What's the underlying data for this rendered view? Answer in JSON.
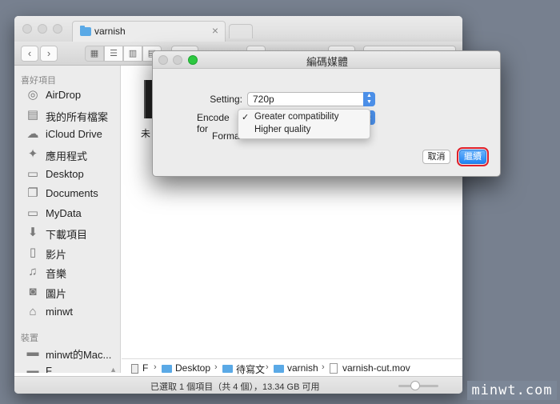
{
  "finder": {
    "tab_title": "varnish",
    "tab_close": "×",
    "sidebar": {
      "favorites_header": "喜好項目",
      "favorites": [
        {
          "label": "AirDrop",
          "icon": "airdrop-icon"
        },
        {
          "label": "我的所有檔案",
          "icon": "all-files-icon"
        },
        {
          "label": "iCloud Drive",
          "icon": "cloud-icon"
        },
        {
          "label": "應用程式",
          "icon": "applications-icon"
        },
        {
          "label": "Desktop",
          "icon": "folder-icon"
        },
        {
          "label": "Documents",
          "icon": "document-icon"
        },
        {
          "label": "MyData",
          "icon": "folder-icon"
        },
        {
          "label": "下載項目",
          "icon": "download-icon"
        },
        {
          "label": "影片",
          "icon": "film-icon"
        },
        {
          "label": "音樂",
          "icon": "music-icon"
        },
        {
          "label": "圖片",
          "icon": "camera-icon"
        },
        {
          "label": "minwt",
          "icon": "home-icon"
        }
      ],
      "devices_header": "裝置",
      "devices": [
        {
          "label": "minwt的Mac...",
          "icon": "disk-icon"
        },
        {
          "label": "F",
          "icon": "disk-icon"
        }
      ]
    },
    "file_label": "未",
    "pathbar": [
      "F",
      "Desktop",
      "待寫文",
      "varnish",
      "varnish-cut.mov"
    ],
    "status": "已選取 1 個項目（共 4 個），13.34 GB 可用"
  },
  "dialog": {
    "title": "編碼媒體",
    "setting_label": "Setting:",
    "setting_value": "720p",
    "encode_label": "Encode for",
    "format_label": "Format",
    "menu": [
      {
        "label": "Greater compatibility",
        "checked": true
      },
      {
        "label": "Higher quality",
        "checked": false
      }
    ],
    "check_mark": "✓",
    "cancel_label": "取消",
    "continue_label": "繼續"
  },
  "watermark": "minwt.com"
}
